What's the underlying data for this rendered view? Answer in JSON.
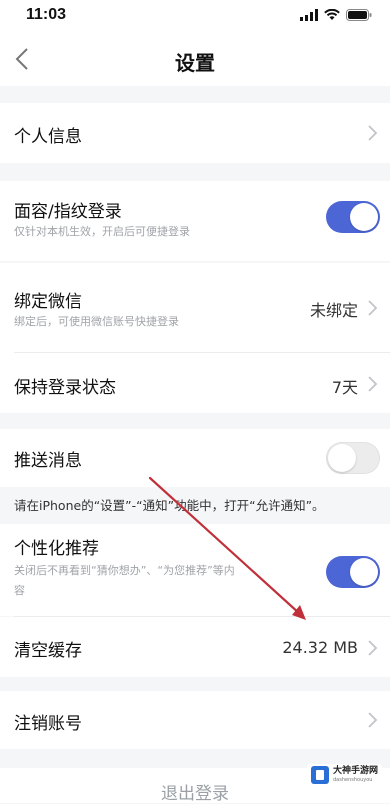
{
  "status_bar": {
    "time": "11:03"
  },
  "nav": {
    "title": "设置"
  },
  "rows": {
    "personal_info": {
      "title": "个人信息"
    },
    "face_login": {
      "title": "面容/指纹登录",
      "subtitle": "仅针对本机生效，开启后可便捷登录",
      "toggle_on": true
    },
    "bind_wechat": {
      "title": "绑定微信",
      "subtitle": "绑定后，可使用微信账号快捷登录",
      "value": "未绑定"
    },
    "keep_login": {
      "title": "保持登录状态",
      "value": "7天"
    },
    "push": {
      "title": "推送消息",
      "toggle_on": false
    },
    "push_notice": "请在iPhone的“设置”-“通知”功能中，打开“允许通知”。",
    "personalized": {
      "title": "个性化推荐",
      "subtitle_line1": "关闭后不再看到“猜你想办”、“为您推荐”等内",
      "subtitle_line2": "容",
      "toggle_on": true
    },
    "clear_cache": {
      "title": "清空缓存",
      "value": "24.32 MB"
    },
    "cancel_account": {
      "title": "注销账号"
    }
  },
  "logout": {
    "label": "退出登录"
  },
  "watermark": {
    "brand": "大神手游网",
    "sub": "dashenshouyou"
  },
  "colors": {
    "accent": "#4d66d6",
    "background": "#f5f6f8",
    "annotation_arrow": "#c0303a"
  }
}
